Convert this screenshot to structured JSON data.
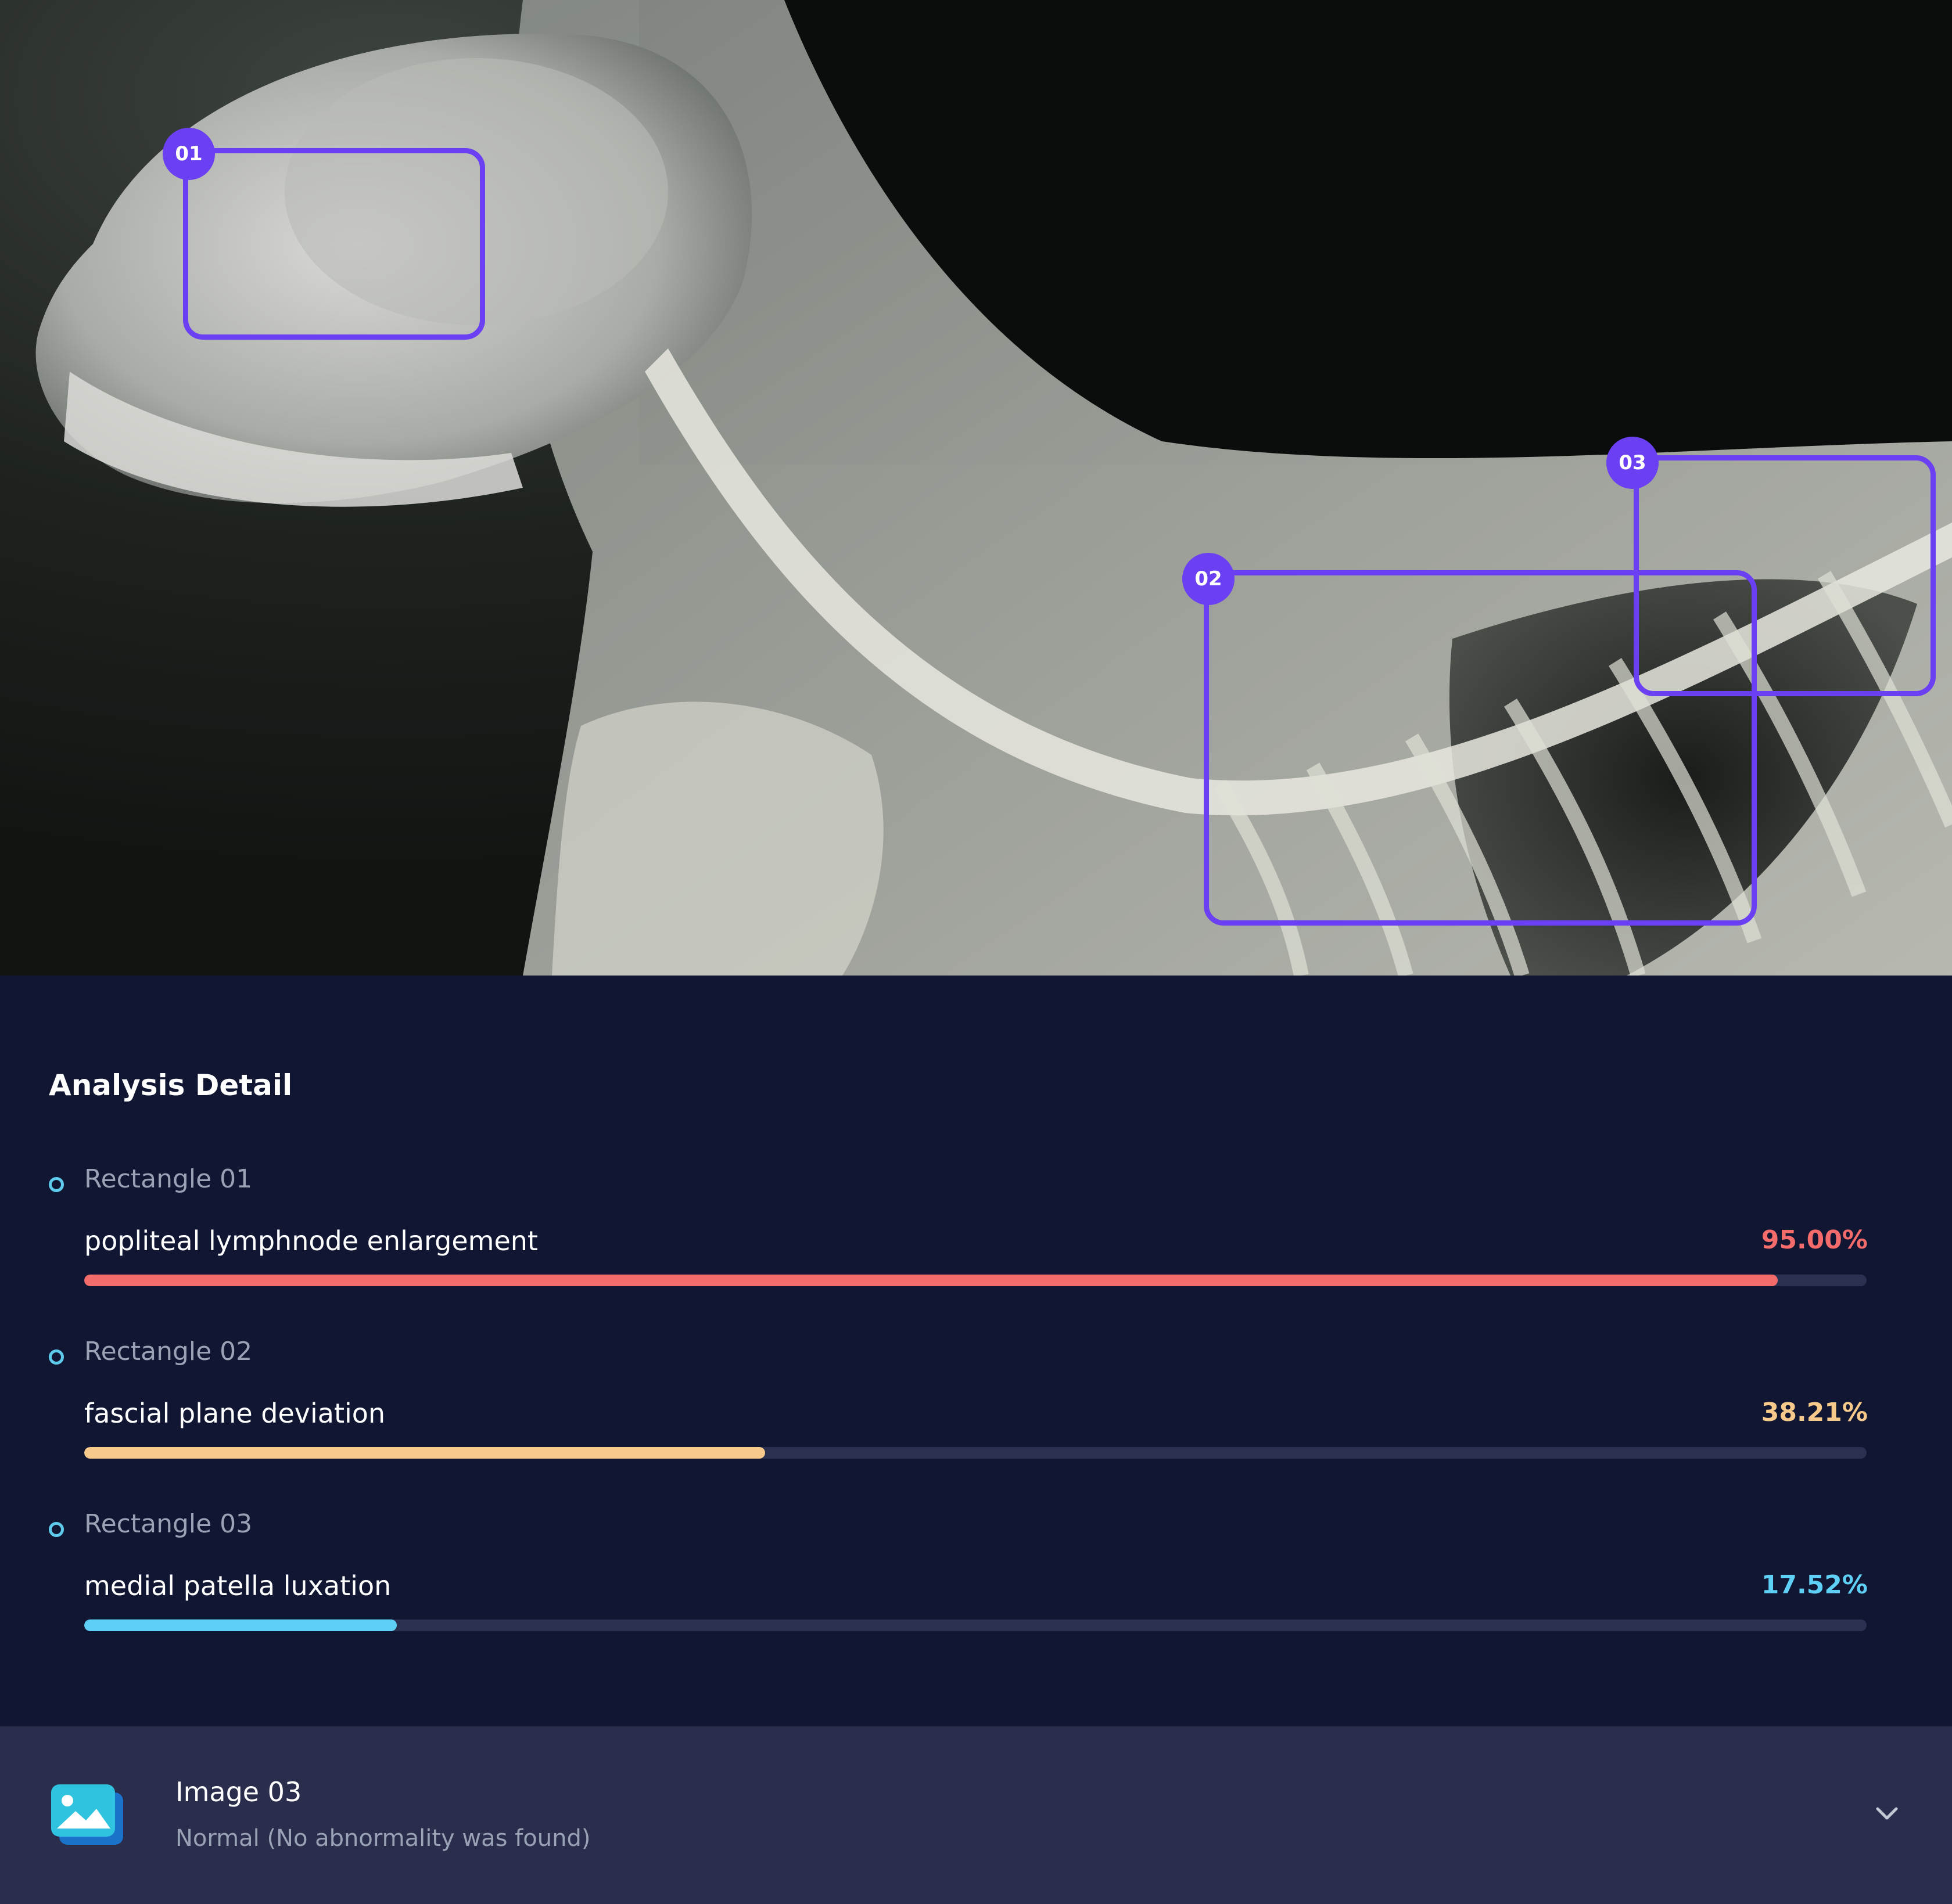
{
  "image": {
    "regions": [
      {
        "badge": "01"
      },
      {
        "badge": "02"
      },
      {
        "badge": "03"
      }
    ],
    "accent_color": "#6b3ff2"
  },
  "analysis": {
    "title": "Analysis Detail",
    "findings": [
      {
        "rect_label": "Rectangle 01",
        "name": "popliteal lymphnode enlargement",
        "percent_text": "95.00%",
        "value": 0.95,
        "color": "#f36b6b"
      },
      {
        "rect_label": "Rectangle 02",
        "name": "fascial plane deviation",
        "percent_text": "38.21%",
        "value": 0.3821,
        "color": "#f7c98a"
      },
      {
        "rect_label": "Rectangle 03",
        "name": "medial patella luxation",
        "percent_text": "17.52%",
        "value": 0.1752,
        "color": "#5fd0f5"
      }
    ]
  },
  "image_item": {
    "title": "Image 03",
    "subtitle": "Normal (No abnormality was found)",
    "icon": "image-icon",
    "expand_icon": "chevron-down-icon"
  }
}
